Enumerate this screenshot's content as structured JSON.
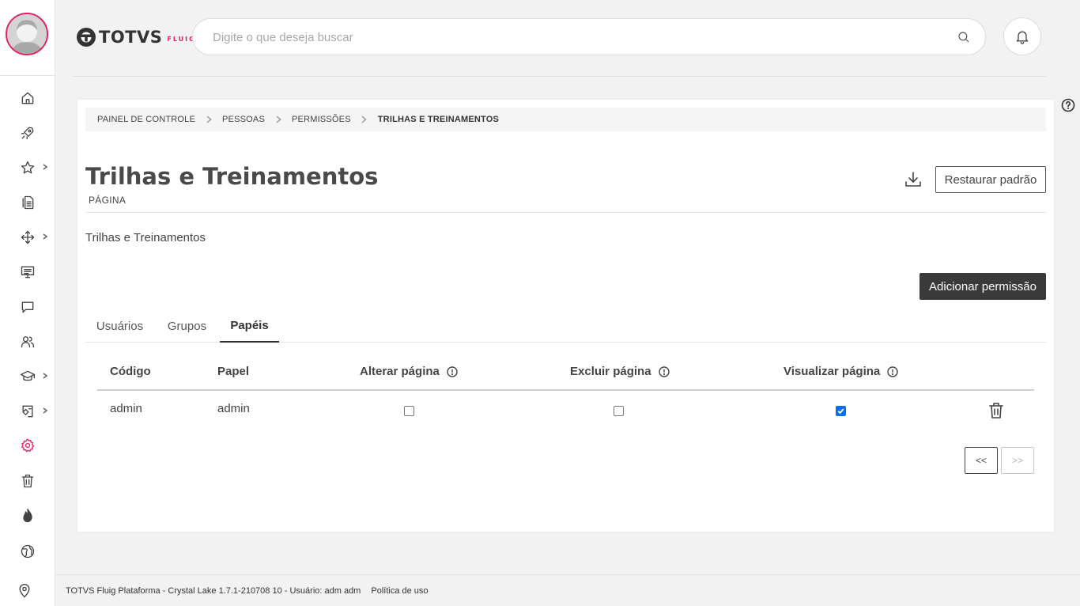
{
  "colors": {
    "accent": "#e0245e",
    "dark_button": "#3a3a3a",
    "checkbox_checked": "#0b6ff3"
  },
  "header": {
    "logo_text": "TOTVS",
    "logo_sub": "FLUIG",
    "search_placeholder": "Digite o que deseja buscar",
    "icons": [
      "search-icon",
      "bell-icon",
      "help-icon"
    ]
  },
  "sidebar": {
    "items": [
      {
        "icon": "home-icon"
      },
      {
        "icon": "rocket-icon"
      },
      {
        "icon": "star-icon",
        "has_submenu": true
      },
      {
        "icon": "documents-icon"
      },
      {
        "icon": "workflow-icon",
        "has_submenu": true
      },
      {
        "icon": "presentation-icon"
      },
      {
        "icon": "chat-icon"
      },
      {
        "icon": "users-icon"
      },
      {
        "icon": "graduation-cap-icon",
        "has_submenu": true
      },
      {
        "icon": "knowledge-icon",
        "has_submenu": true
      },
      {
        "icon": "gear-icon",
        "active": true
      },
      {
        "icon": "trash-icon"
      },
      {
        "icon": "flame-icon"
      },
      {
        "icon": "globe-icon"
      }
    ],
    "bottom_icon": "location-pin-icon"
  },
  "breadcrumb": [
    "PAINEL DE CONTROLE",
    "PESSOAS",
    "PERMISSÕES",
    "TRILHAS E TREINAMENTOS"
  ],
  "page": {
    "title": "Trilhas e Treinamentos",
    "subtitle": "PÁGINA",
    "description": "Trilhas e Treinamentos",
    "restore_label": "Restaurar padrão",
    "add_permission_label": "Adicionar permissão"
  },
  "tabs": [
    {
      "label": "Usuários",
      "active": false
    },
    {
      "label": "Grupos",
      "active": false
    },
    {
      "label": "Papéis",
      "active": true
    }
  ],
  "table": {
    "columns": [
      "Código",
      "Papel",
      "Alterar página",
      "Excluir página",
      "Visualizar página"
    ],
    "rows": [
      {
        "codigo": "admin",
        "papel": "admin",
        "alterar": false,
        "excluir": false,
        "visualizar": true
      }
    ]
  },
  "pagination": {
    "prev_label": "<<",
    "next_label": ">>",
    "next_disabled": true
  },
  "footer": {
    "text": "TOTVS Fluig Plataforma - Crystal Lake 1.7.1-210708 10 - Usuário: adm adm",
    "link": "Política de uso"
  }
}
